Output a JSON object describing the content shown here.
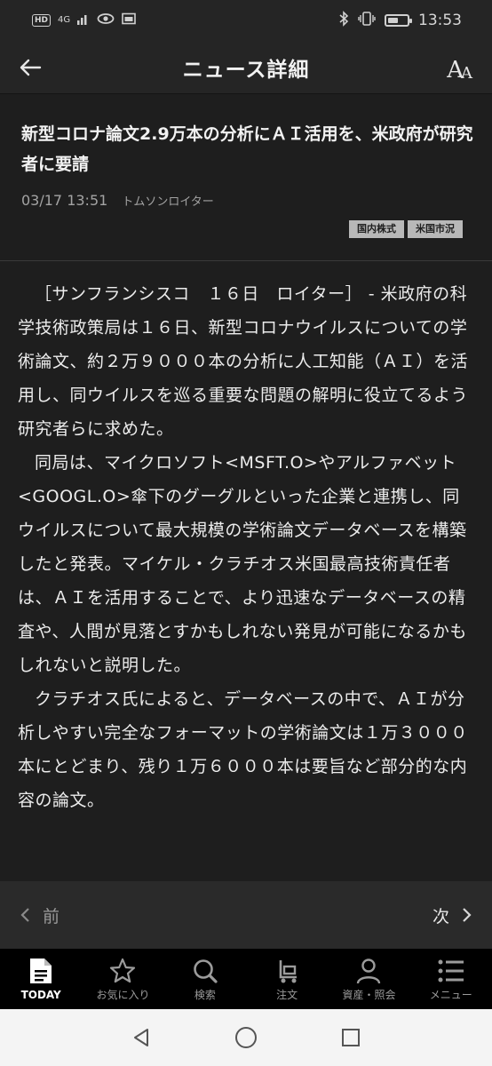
{
  "status_bar": {
    "hd": "HD",
    "network": "4G",
    "time": "13:53",
    "battery_level": 0.55
  },
  "header": {
    "title": "ニュース詳細"
  },
  "article": {
    "title": "新型コロナ論文2.9万本の分析にＡＩ活用を、米政府が研究者に要請",
    "date": "03/17 13:51",
    "source": "トムソンロイター",
    "tags": [
      "国内株式",
      "米国市況"
    ],
    "paragraphs": [
      "［サンフランシスコ　１６日　ロイター］ - 米政府の科学技術政策局は１６日、新型コロナウイルスについての学術論文、約２万９０００本の分析に人工知能（ＡＩ）を活用し、同ウイルスを巡る重要な問題の解明に役立てるよう研究者らに求めた。",
      "同局は、マイクロソフト<MSFT.O>やアルファベット<GOOGL.O>傘下のグーグルといった企業と連携し、同ウイルスについて最大規模の学術論文データベースを構築したと発表。マイケル・クラチオス米国最高技術責任者は、ＡＩを活用することで、より迅速なデータベースの精査や、人間が見落とすかもしれない発見が可能になるかもしれないと説明した。",
      "クラチオス氏によると、データベースの中で、ＡＩが分析しやすい完全なフォーマットの学術論文は１万３０００本にとどまり、残り１万６０００本は要旨など部分的な内容の論文。"
    ]
  },
  "pager": {
    "prev_label": "前",
    "next_label": "次"
  },
  "bottom_nav": {
    "items": [
      {
        "label": "TODAY",
        "icon": "today-document-icon"
      },
      {
        "label": "お気に入り",
        "icon": "star-icon"
      },
      {
        "label": "検索",
        "icon": "search-icon"
      },
      {
        "label": "注文",
        "icon": "cart-icon"
      },
      {
        "label": "資産・照会",
        "icon": "person-icon"
      },
      {
        "label": "メニュー",
        "icon": "menu-list-icon"
      }
    ]
  },
  "colors": {
    "background": "#1e1e1e",
    "header": "#252525",
    "nav_background": "#000000",
    "tag_background": "#b8b8b8"
  }
}
